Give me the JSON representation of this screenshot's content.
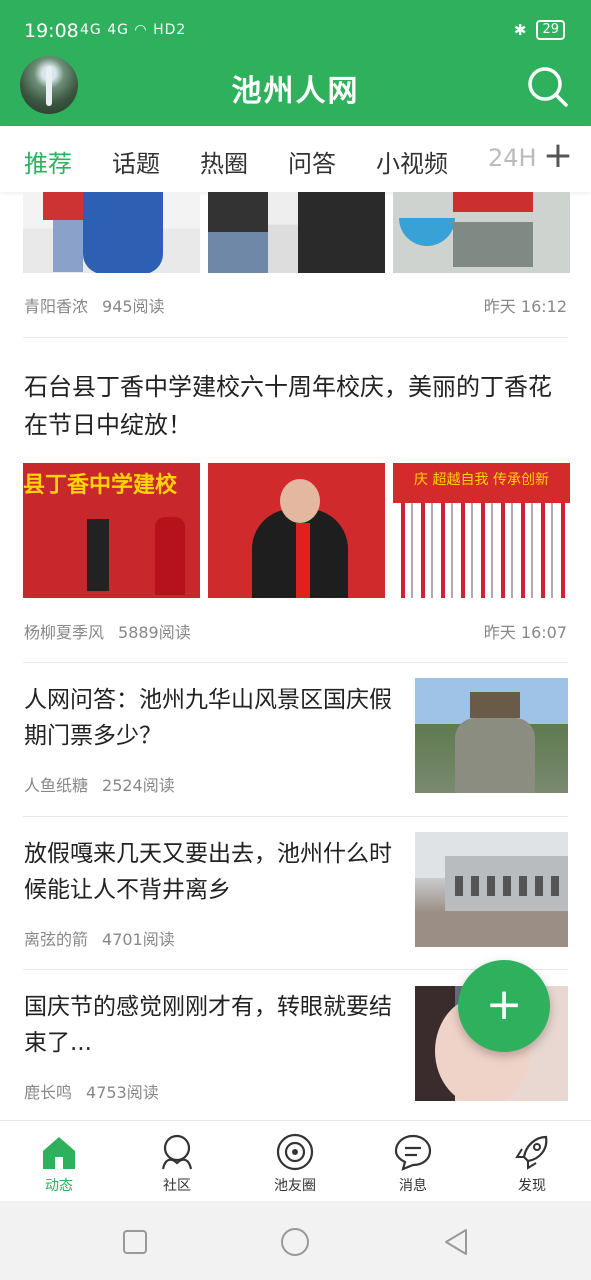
{
  "status": {
    "time": "19:08",
    "signal": "4G 4G",
    "hd": "HD2",
    "battery": "29"
  },
  "header": {
    "title": "池州人网"
  },
  "tabs": [
    {
      "label": "推荐"
    },
    {
      "label": "话题"
    },
    {
      "label": "热圈"
    },
    {
      "label": "问答"
    },
    {
      "label": "小视频"
    },
    {
      "label": "24H"
    }
  ],
  "tab_plus": "+",
  "articles": [
    {
      "author": "青阳香浓",
      "reads": "945阅读",
      "time": "昨天 16:12"
    },
    {
      "title": "石台县丁香中学建校六十周年校庆，美丽的丁香花在节日中绽放！",
      "author": "杨柳夏季风",
      "reads": "5889阅读",
      "time": "昨天 16:07",
      "thumb_banner_1": "县丁香中学建校",
      "thumb_banner_3": "庆   超越自我   传承创新"
    },
    {
      "title": "人网问答：池州九华山风景区国庆假期门票多少？",
      "author": "人鱼纸糖",
      "reads": "2524阅读"
    },
    {
      "title": "放假嘎来几天又要出去，池州什么时候能让人不背井离乡",
      "author": "离弦的箭",
      "reads": "4701阅读"
    },
    {
      "title": "国庆节的感觉刚刚才有，转眼就要结束了...",
      "author": "鹿长鸣",
      "reads": "4753阅读"
    }
  ],
  "fab_label": "+",
  "bottom_nav": [
    {
      "label": "动态",
      "icon": "home-icon"
    },
    {
      "label": "社区",
      "icon": "community-icon"
    },
    {
      "label": "池友圈",
      "icon": "circle-icon"
    },
    {
      "label": "消息",
      "icon": "message-icon"
    },
    {
      "label": "发现",
      "icon": "rocket-icon"
    }
  ],
  "colors": {
    "brand": "#2eb05c"
  }
}
